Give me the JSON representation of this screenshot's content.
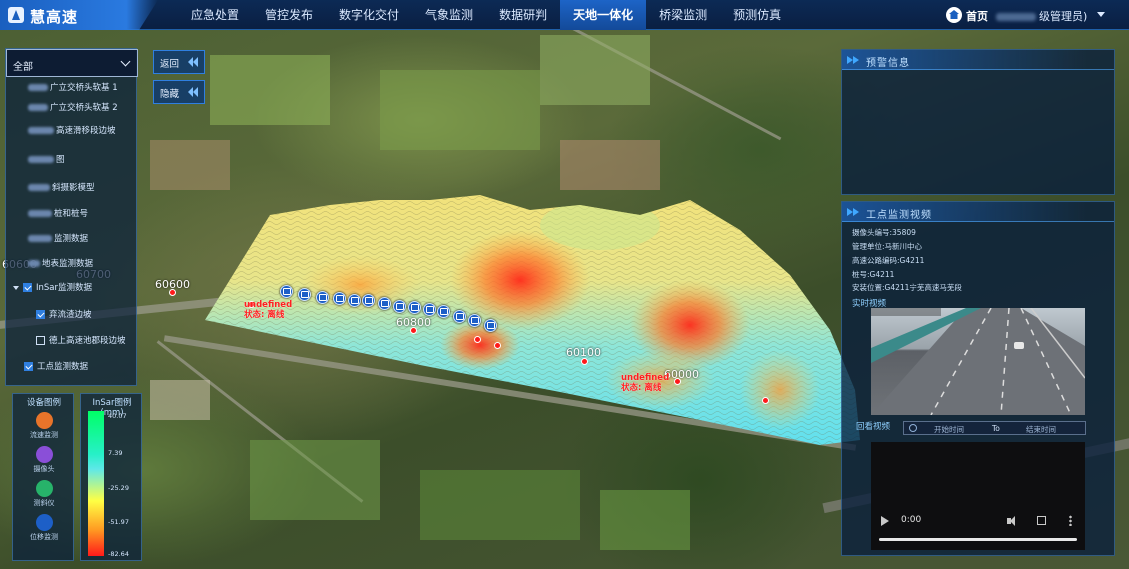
{
  "header": {
    "title": "慧高速",
    "nav": [
      "应急处置",
      "管控发布",
      "数字化交付",
      "气象监测",
      "数据研判",
      "天地一体化",
      "桥梁监测",
      "预测仿真"
    ],
    "active_nav": "天地一体化",
    "home_label": "首页",
    "user_label": "级管理员)"
  },
  "left_panel": {
    "select_value": "全部",
    "items": [
      {
        "label": "广立交桥头软基 1",
        "checkbox": "none"
      },
      {
        "label": "广立交桥头软基 2",
        "checkbox": "none"
      },
      {
        "label": "高速滑移段边坡",
        "checkbox": "none"
      },
      {
        "label": "图",
        "checkbox": "none"
      },
      {
        "label": "斜摄影模型",
        "checkbox": "none"
      },
      {
        "label": "桩和桩号",
        "checkbox": "none"
      },
      {
        "label": "监测数据",
        "checkbox": "none"
      },
      {
        "label": "地表监测数据",
        "checkbox": "none"
      },
      {
        "label": "InSar监测数据",
        "checkbox": "checked"
      },
      {
        "label": "弃流渣边坡",
        "checkbox": "checked"
      },
      {
        "label": "德上高速池郡段边坡",
        "checkbox": "unchecked"
      },
      {
        "label": "工点监测数据",
        "checkbox": "checked"
      }
    ]
  },
  "buttons": {
    "back": "返回",
    "hide": "隐藏"
  },
  "device_legend": {
    "title": "设备图例",
    "items": [
      {
        "label": "流速监测",
        "icon": "flow-sensor-icon",
        "color": "#e8742a"
      },
      {
        "label": "摄像头",
        "icon": "camera-icon",
        "color": "#8a4fd8"
      },
      {
        "label": "测斜仪",
        "icon": "inclinometer-icon",
        "color": "#27b36a"
      },
      {
        "label": "位移监测",
        "icon": "displacement-icon",
        "color": "#1d5fc7"
      }
    ]
  },
  "insar_legend": {
    "title": "InSar图例(mm)",
    "ticks": [
      "40.07",
      "7.39",
      "-25.29",
      "-51.97",
      "-82.64"
    ]
  },
  "map": {
    "numbers": [
      "60600",
      "60700",
      "60600",
      "60800",
      "60100",
      "60000"
    ],
    "alerts": [
      {
        "line1": "undefined",
        "line2": "状态: 离线"
      },
      {
        "line1": "undefined",
        "line2": "状态: 离线"
      }
    ]
  },
  "warning_panel": {
    "title": "预警信息"
  },
  "video_panel": {
    "title": "工点监测视频",
    "info": [
      "摄像头编号:35809",
      "管理单位:马新川中心",
      "高速公路编码:G4211",
      "桩号:G4211",
      "安装位置:G4211宁芜高速马芜段"
    ],
    "live_label": "实时视频",
    "playback_label": "回看视频",
    "start_placeholder": "开始时间",
    "to_label": "To",
    "end_placeholder": "结束时间",
    "player_time": "0:00"
  }
}
